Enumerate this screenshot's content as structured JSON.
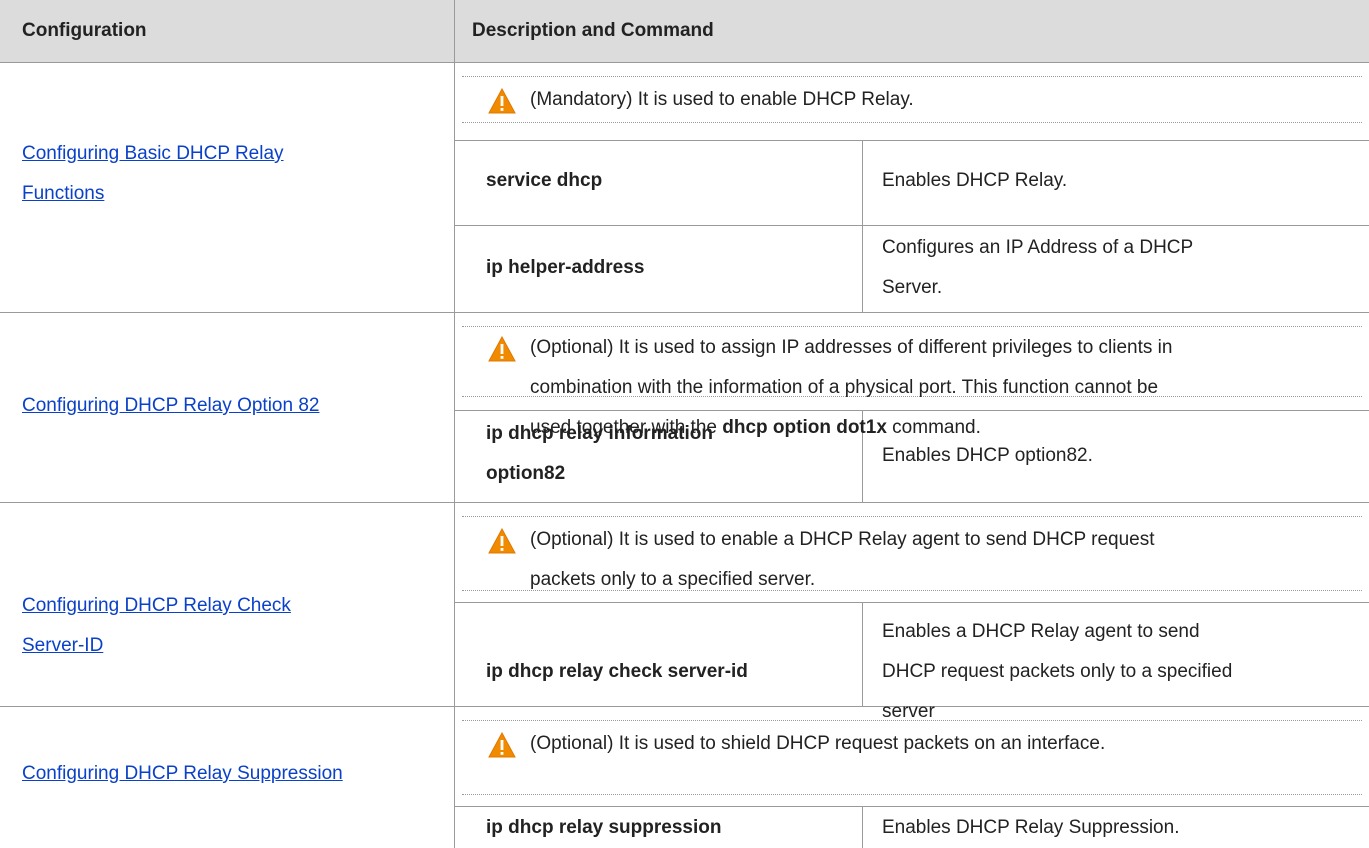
{
  "header": {
    "col1": "Configuration",
    "col2": "Description and Command"
  },
  "rows": [
    {
      "config": [
        "Configuring Basic DHCP Relay ",
        "Functions"
      ],
      "note": "(Mandatory) It is used to enable DHCP Relay.",
      "commands": [
        {
          "command": "service dhcp",
          "description": "Enables DHCP Relay."
        },
        {
          "command": "ip helper-address",
          "description": [
            "Configures an IP Address of a DHCP",
            "Server."
          ]
        }
      ]
    },
    {
      "config": [
        "Configuring DHCP Relay Option 82"
      ],
      "note": {
        "line1": "(Optional) It is used to assign IP addresses of different privileges to clients in",
        "line2": "combination with the information of a physical port. This function cannot be",
        "line3_pre": "used together with the ",
        "line3_bold": "dhcp option dot1x",
        "line3_post": " command."
      },
      "commands": [
        {
          "command": [
            "ip dhcp relay information",
            "option82"
          ],
          "description": "Enables DHCP option82."
        }
      ]
    },
    {
      "config": [
        "Configuring DHCP Relay Check ",
        "Server-ID"
      ],
      "note": [
        "(Optional) It is used to enable a DHCP Relay agent to send DHCP request",
        "packets only to a specified server."
      ],
      "commands": [
        {
          "command": "ip dhcp relay check server-id",
          "description": [
            "Enables a DHCP Relay agent to send",
            "DHCP request packets only to a specified",
            "server"
          ]
        }
      ]
    },
    {
      "config": [
        "Configuring DHCP Relay Suppression"
      ],
      "note": "(Optional) It is used to shield DHCP request packets on an interface.",
      "commands": [
        {
          "command": "ip dhcp relay suppression",
          "description": "Enables DHCP Relay Suppression."
        }
      ]
    }
  ],
  "icons": {
    "warning": "warning-triangle-icon",
    "warning_color": "#f08a00",
    "link_color": "#0a41c8"
  }
}
